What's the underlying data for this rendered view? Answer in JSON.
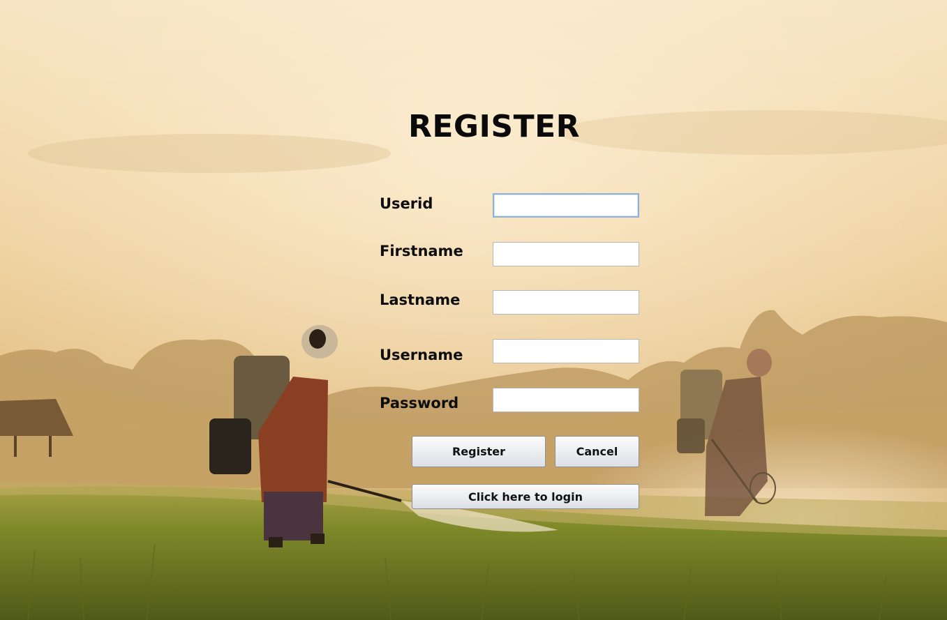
{
  "form": {
    "title": "REGISTER",
    "fields": [
      {
        "label": "Userid",
        "value": ""
      },
      {
        "label": "Firstname",
        "value": ""
      },
      {
        "label": "Lastname",
        "value": ""
      },
      {
        "label": "Username",
        "value": ""
      },
      {
        "label": "Password",
        "value": ""
      }
    ],
    "focused_field": "Userid",
    "buttons": {
      "register_label": "Register",
      "cancel_label": "Cancel",
      "login_label": "Click here to login"
    }
  },
  "background": {
    "scene": "sunrise-rice-field-with-farmers-spraying",
    "sky_color": "#f4ddb0",
    "grass_color": "#6e7a24"
  }
}
